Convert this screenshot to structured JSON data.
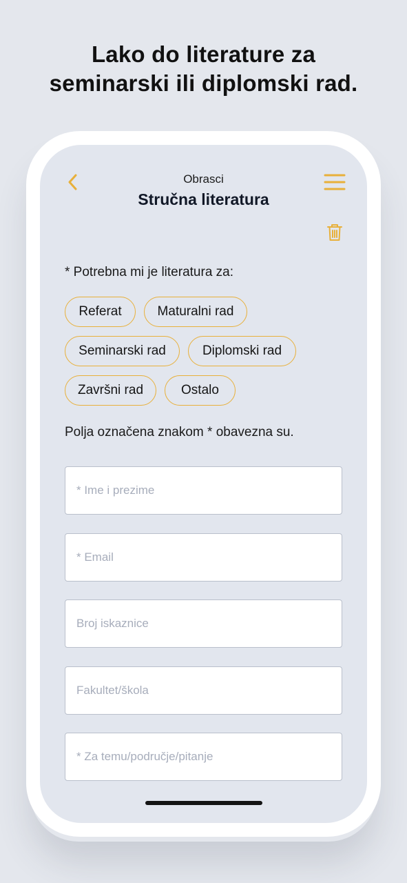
{
  "headline": {
    "line1": "Lako do literature za",
    "line2": "seminarski ili diplomski rad."
  },
  "header": {
    "subtitle": "Obrasci",
    "title": "Stručna literatura",
    "back_icon": "chevron-left-icon",
    "menu_icon": "hamburger-menu-icon",
    "trash_icon": "trash-icon"
  },
  "prompt": "* Potrebna mi je literatura za:",
  "chips": [
    "Referat",
    "Maturalni rad",
    "Seminarski rad",
    "Diplomski rad",
    "Završni rad",
    "Ostalo"
  ],
  "required_note": "Polja označena znakom * obavezna su.",
  "fields": [
    {
      "placeholder": "* Ime i prezime",
      "value": ""
    },
    {
      "placeholder": "* Email",
      "value": ""
    },
    {
      "placeholder": "Broj iskaznice",
      "value": ""
    },
    {
      "placeholder": "Fakultet/škola",
      "value": ""
    },
    {
      "placeholder": "* Za temu/područje/pitanje",
      "value": ""
    }
  ],
  "colors": {
    "accent": "#e8b03a",
    "background": "#e4e7ed",
    "screen": "#e2e6ee",
    "text": "#111111",
    "placeholder": "#a7adbb"
  }
}
